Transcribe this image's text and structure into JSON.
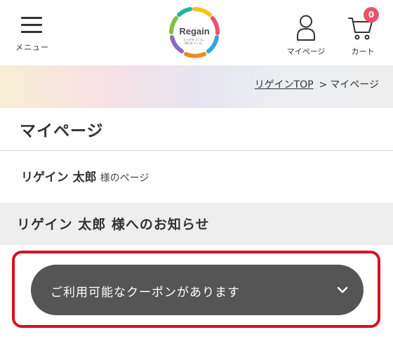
{
  "header": {
    "menu_label": "メニュー",
    "logo_text": "Regain",
    "logo_tagline_1": "カラダをつくる。",
    "logo_tagline_2": "明日をつくる。",
    "mypage_label": "マイページ",
    "cart_label": "カート",
    "cart_count": "0",
    "icons": {
      "menu": "hamburger-icon",
      "mypage": "user-icon",
      "cart": "cart-icon"
    }
  },
  "breadcrumb": {
    "home": "リゲインTOP",
    "separator": ">",
    "current": "マイページ"
  },
  "page": {
    "title": "マイページ",
    "greeting_name": "リゲイン 太郎",
    "greeting_suffix": "様のページ",
    "notice_title": "リゲイン 太郎 様へのお知らせ"
  },
  "coupon": {
    "label": "ご利用可能なクーポンがあります",
    "icon": "chevron-down-icon"
  },
  "colors": {
    "badge": "#e7536a",
    "coupon_bg": "#555555",
    "highlight": "#d9101f",
    "notice_bg": "#eeeeee"
  }
}
